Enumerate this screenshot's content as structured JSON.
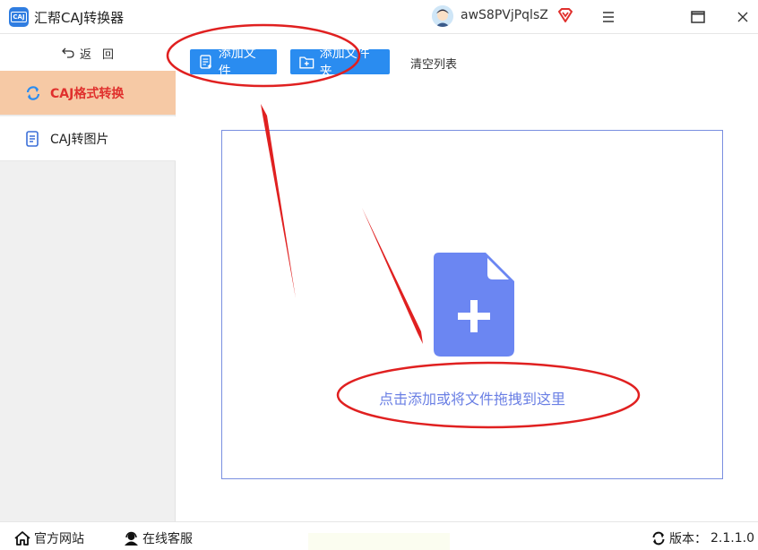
{
  "titlebar": {
    "logo_text": "CAJ",
    "app_title": "汇帮CAJ转换器",
    "username": "awS8PVjPqlsZ",
    "icons": [
      "avatar",
      "vip-heart-icon",
      "menu-icon",
      "maximize-icon",
      "close-icon"
    ]
  },
  "sidebar": {
    "back_label": "返回",
    "items": [
      {
        "label": "CAJ格式转换",
        "icon": "refresh-icon",
        "active": true
      },
      {
        "label": "CAJ转图片",
        "icon": "document-icon",
        "active": false
      }
    ]
  },
  "toolbar": {
    "add_file_label": "添加文件",
    "add_folder_label": "添加文件夹",
    "clear_label": "清空列表"
  },
  "dropzone": {
    "hint": "点击添加或将文件拖拽到这里",
    "icon": "add-document-icon"
  },
  "footer": {
    "site_label": "官方网站",
    "service_label": "在线客服",
    "version_prefix": "版本：",
    "version": "2.1.1.0"
  },
  "colors": {
    "accent": "#2a8cf0",
    "active_nav_bg": "#f6c9a5",
    "active_nav_text": "#e0302d",
    "drop_icon": "#6b86f2",
    "annotation": "#e02020"
  }
}
